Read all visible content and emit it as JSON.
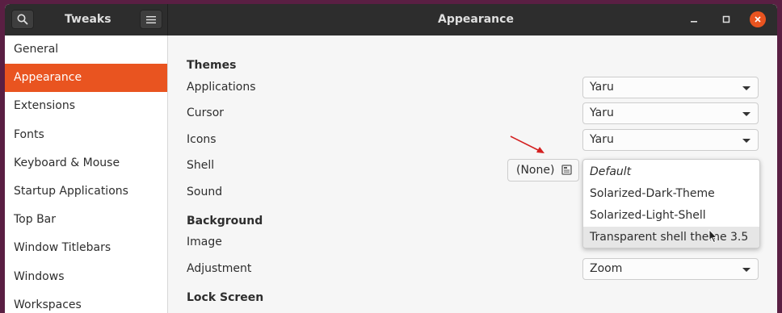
{
  "sidebar_header": {
    "title": "Tweaks"
  },
  "main_header": {
    "title": "Appearance"
  },
  "sidebar": {
    "items": [
      {
        "label": "General"
      },
      {
        "label": "Appearance",
        "active": true
      },
      {
        "label": "Extensions"
      },
      {
        "label": "Fonts"
      },
      {
        "label": "Keyboard & Mouse"
      },
      {
        "label": "Startup Applications"
      },
      {
        "label": "Top Bar"
      },
      {
        "label": "Window Titlebars"
      },
      {
        "label": "Windows"
      },
      {
        "label": "Workspaces"
      }
    ]
  },
  "main": {
    "themes_heading": "Themes",
    "applications_label": "Applications",
    "applications_value": "Yaru",
    "cursor_label": "Cursor",
    "cursor_value": "Yaru",
    "icons_label": "Icons",
    "icons_value": "Yaru",
    "shell_label": "Shell",
    "shell_value": "(None)",
    "sound_label": "Sound",
    "background_heading": "Background",
    "image_label": "Image",
    "adjustment_label": "Adjustment",
    "adjustment_value": "Zoom",
    "lock_screen_heading": "Lock Screen"
  },
  "shell_popup": {
    "options": [
      "Default",
      "Solarized-Dark-Theme",
      "Solarized-Light-Shell",
      "Transparent shell theme 3.5"
    ],
    "highlighted": "Transparent shell theme 3.5"
  },
  "colors": {
    "accent": "#e95420",
    "header_bg": "#2d2d2d",
    "annotation_arrow": "#d42020"
  },
  "icons": [
    "search-icon",
    "hamburger-menu-icon",
    "minimize-icon",
    "maximize-icon",
    "close-icon",
    "file-open-icon",
    "mouse-pointer-icon",
    "annotation-arrow"
  ]
}
